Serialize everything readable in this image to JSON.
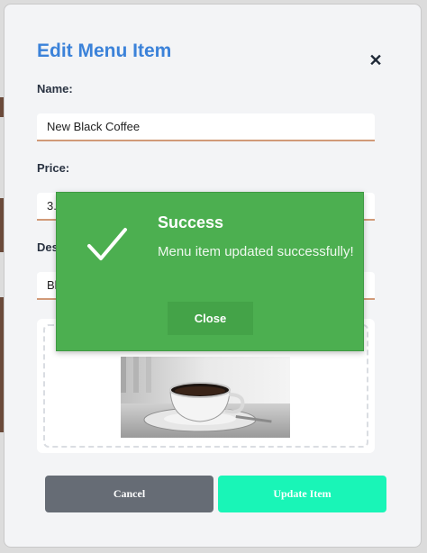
{
  "modal": {
    "title": "Edit Menu Item",
    "close_icon": "close-icon",
    "fields": {
      "name": {
        "label": "Name:",
        "value": "New Black Coffee"
      },
      "price": {
        "label": "Price:",
        "value": "3.7"
      },
      "description": {
        "label": "Des",
        "value": "Bla"
      }
    },
    "image": {
      "icon": "coffee-cup-photo"
    },
    "buttons": {
      "cancel": "Cancel",
      "update": "Update Item"
    }
  },
  "toast": {
    "icon": "checkmark-icon",
    "title": "Success",
    "message": "Menu item updated successfully!",
    "close_label": "Close"
  },
  "colors": {
    "title": "#3b82d9",
    "toast_bg": "#4caf50",
    "cancel_bg": "#666c75",
    "update_bg": "#19f5b7",
    "input_underline": "#d19a78"
  }
}
